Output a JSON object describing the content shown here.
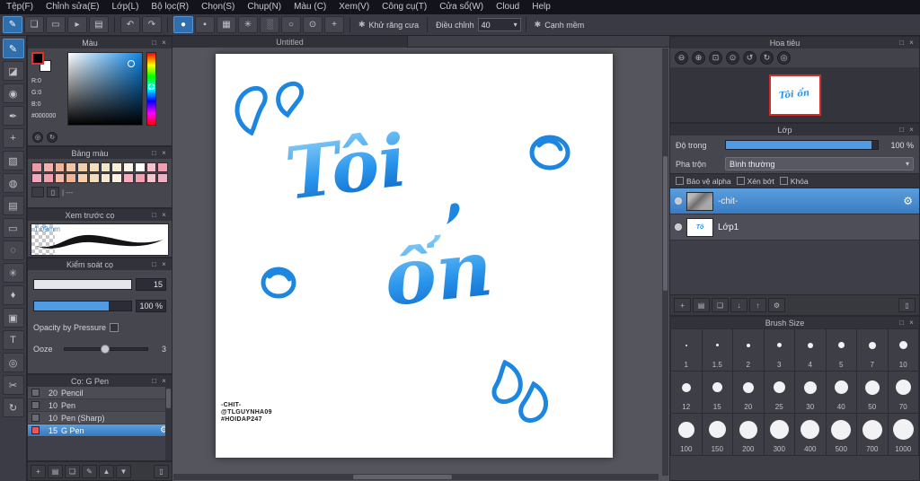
{
  "menu": {
    "items": [
      "Tệp(F)",
      "Chỉnh sửa(E)",
      "Lớp(L)",
      "Bộ lọc(R)",
      "Chọn(S)",
      "Chụp(N)",
      "Màu (C)",
      "Xem(V)",
      "Công cụ(T)",
      "Cửa sổ(W)",
      "Cloud",
      "Help"
    ]
  },
  "toolbar": {
    "antialias_label": "Khử răng cưa",
    "adjust_label": "Điều chỉnh",
    "adjust_value": "40",
    "soft_edge_label": "Cạnh mềm"
  },
  "toolbar_icons": [
    {
      "name": "pen-mode",
      "glyph": "✎"
    },
    {
      "name": "panels",
      "glyph": "❏"
    },
    {
      "name": "window",
      "glyph": "▭"
    },
    {
      "name": "pointer",
      "glyph": "▸"
    },
    {
      "name": "layers",
      "glyph": "▤"
    }
  ],
  "tip_icons": [
    {
      "name": "tip-circle",
      "glyph": "●"
    },
    {
      "name": "tip-square",
      "glyph": "▪"
    },
    {
      "name": "tip-grid",
      "glyph": "▦"
    },
    {
      "name": "tip-star",
      "glyph": "✳"
    },
    {
      "name": "tip-spray",
      "glyph": "░"
    },
    {
      "name": "tip-ring",
      "glyph": "○"
    },
    {
      "name": "tip-target",
      "glyph": "⊙"
    },
    {
      "name": "tip-cross",
      "glyph": "+"
    }
  ],
  "tools": [
    {
      "name": "brush",
      "glyph": "✎"
    },
    {
      "name": "eraser",
      "glyph": "◪"
    },
    {
      "name": "blur",
      "glyph": "◉"
    },
    {
      "name": "pen",
      "glyph": "✒"
    },
    {
      "name": "move",
      "glyph": "+"
    },
    {
      "name": "fill",
      "glyph": "▨"
    },
    {
      "name": "bucket",
      "glyph": "◍"
    },
    {
      "name": "gradient",
      "glyph": "▤"
    },
    {
      "name": "select",
      "glyph": "▭"
    },
    {
      "name": "lasso",
      "glyph": "◌"
    },
    {
      "name": "magic-wand",
      "glyph": "✳"
    },
    {
      "name": "stamp",
      "glyph": "♦"
    },
    {
      "name": "panel",
      "glyph": "▣"
    },
    {
      "name": "text",
      "glyph": "T"
    },
    {
      "name": "eyedropper",
      "glyph": "◎"
    },
    {
      "name": "scissors",
      "glyph": "✂"
    },
    {
      "name": "rotate",
      "glyph": "↻"
    }
  ],
  "color_panel": {
    "title": "Màu",
    "r": "R:0",
    "g": "G:0",
    "b": "B:0",
    "hex": "#000000",
    "foreground": "#000000",
    "background": "#ffffff"
  },
  "palette_panel": {
    "title": "Bảng màu",
    "footer_text": "| ---",
    "colors_row1": [
      "#e89ca4",
      "#f2b2ac",
      "#eeb49c",
      "#f4c4a4",
      "#f0d0ac",
      "#f6debc",
      "#f2e6c8",
      "#f8eed8",
      "#fdf6e8",
      "#ffffff",
      "#f4c2ca",
      "#ee9eae"
    ],
    "colors_row2": [
      "#f2a8bc",
      "#eea0ac",
      "#f4bca8",
      "#f0b498",
      "#f6d0ae",
      "#f2dcc0",
      "#f8e8d0",
      "#fcf2e2",
      "#f6aebe",
      "#f0a2b2",
      "#f4c6ce",
      "#eeb0c4"
    ]
  },
  "preview_panel": {
    "title": "Xem trước cọ",
    "size_label": "1.09mm"
  },
  "control_panel": {
    "title": "Kiểm soát cọ",
    "size_value": "15",
    "opacity_value": "100 %",
    "pressure_label": "Opacity by Pressure",
    "ooze_label": "Ooze",
    "ooze_value": "3"
  },
  "brush_list": {
    "title": "Cọ: G Pen",
    "items": [
      {
        "size": "20",
        "name": "Pencil",
        "chip": "#6a6a72"
      },
      {
        "size": "10",
        "name": "Pen",
        "chip": "#6a6a72"
      },
      {
        "size": "10",
        "name": "Pen (Sharp)",
        "chip": "#6a6a72"
      },
      {
        "size": "15",
        "name": "G Pen",
        "chip": "#e85858"
      }
    ]
  },
  "brush_panel_icons": [
    {
      "name": "add-brush",
      "glyph": "+"
    },
    {
      "name": "brush-folder",
      "glyph": "▤"
    },
    {
      "name": "duplicate-brush",
      "glyph": "❏"
    },
    {
      "name": "edit-brush",
      "glyph": "✎"
    },
    {
      "name": "brush-up",
      "glyph": "▲"
    },
    {
      "name": "brush-down",
      "glyph": "▼"
    },
    {
      "name": "delete-brush",
      "glyph": "▯"
    }
  ],
  "canvas": {
    "tab": "Untitled",
    "art_word1": "Tôi",
    "art_word2": "ổn",
    "watermark": [
      "-CHIT-",
      "@TLGUYNHA09",
      "#HOIDAP247"
    ],
    "art_color": "#2b96ec"
  },
  "navigator": {
    "title": "Hoa tiêu",
    "mini_text": "Tôi ổn"
  },
  "nav_icons": [
    {
      "name": "zoom-out",
      "glyph": "⊖"
    },
    {
      "name": "zoom-in",
      "glyph": "⊕"
    },
    {
      "name": "fit-window",
      "glyph": "⊡"
    },
    {
      "name": "actual-size",
      "glyph": "⊙"
    },
    {
      "name": "rotate-ccw",
      "glyph": "↺"
    },
    {
      "name": "rotate-cw",
      "glyph": "↻"
    },
    {
      "name": "reset-view",
      "glyph": "◎"
    }
  ],
  "layer_panel": {
    "title": "Lớp",
    "opacity_label": "Độ trong",
    "opacity_value": "100 %",
    "blend_label": "Pha trộn",
    "blend_value": "Bình thường",
    "protect_alpha_label": "Bảo vệ alpha",
    "clip_label": "Xén bớt",
    "lock_label": "Khóa",
    "layers": [
      {
        "name": "-chit-",
        "selected": true
      },
      {
        "name": "Lớp1",
        "selected": false
      }
    ]
  },
  "layer_icons": [
    {
      "name": "new-layer",
      "glyph": "+"
    },
    {
      "name": "new-folder",
      "glyph": "▤"
    },
    {
      "name": "duplicate-layer",
      "glyph": "❏"
    },
    {
      "name": "merge-down",
      "glyph": "↓"
    },
    {
      "name": "move-up",
      "glyph": "↑"
    },
    {
      "name": "layer-settings",
      "glyph": "⚙"
    },
    {
      "name": "delete-layer",
      "glyph": "▯"
    }
  ],
  "brush_size_panel": {
    "title": "Brush Size",
    "sizes": [
      "1",
      "1.5",
      "2",
      "3",
      "4",
      "5",
      "7",
      "10",
      "12",
      "15",
      "20",
      "25",
      "30",
      "40",
      "50",
      "70",
      "100",
      "150",
      "200",
      "300",
      "400",
      "500",
      "700",
      "1000"
    ]
  },
  "colors": {
    "accent": "#3a7cc2",
    "selection": "#2f6fae",
    "thumb_border": "#d42c2c"
  }
}
